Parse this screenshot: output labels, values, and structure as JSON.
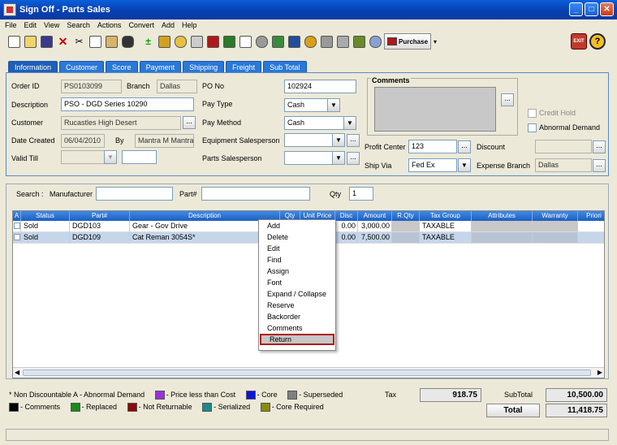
{
  "window": {
    "title": "Sign Off - Parts Sales",
    "min": "_",
    "max": "□",
    "close": "✕"
  },
  "menu": [
    "File",
    "Edit",
    "View",
    "Search",
    "Actions",
    "Convert",
    "Add",
    "Help"
  ],
  "toolbar": {
    "purchase_label": "Purchase",
    "exit_label": "EXIT",
    "help_label": "?"
  },
  "tabs": [
    "Information",
    "Customer",
    "Score",
    "Payment",
    "Shipping",
    "Freight",
    "Sub Total"
  ],
  "info": {
    "order_id_label": "Order ID",
    "order_id": "PS0103099",
    "branch_label": "Branch",
    "branch": "Dallas",
    "po_no_label": "PO No",
    "po_no": "102924",
    "description_label": "Description",
    "description": "PSO - DGD Series 10290",
    "pay_type_label": "Pay Type",
    "pay_type": "Cash",
    "customer_label": "Customer",
    "customer": "Rucastles High Desert",
    "pay_method_label": "Pay Method",
    "pay_method": "Cash",
    "date_created_label": "Date Created",
    "date_created": "06/04/2010",
    "by_label": "By",
    "by": "Mantra M Mantra",
    "equipment_salesperson_label": "Equipment Salesperson",
    "valid_till_label": "Valid Till",
    "parts_salesperson_label": "Parts Salesperson",
    "comments_label": "Comments",
    "credit_hold_label": "Credit Hold",
    "abnormal_demand_label": "Abnormal Demand",
    "profit_center_label": "Profit Center",
    "profit_center": "123",
    "discount_label": "Discount",
    "ship_via_label": "Ship Via",
    "ship_via": "Fed Ex",
    "expense_branch_label": "Expense Branch",
    "expense_branch": "Dallas"
  },
  "search": {
    "label": "Search :",
    "manufacturer_label": "Manufacturer",
    "part_label": "Part#",
    "qty_label": "Qty",
    "qty": "1"
  },
  "grid": {
    "columns": [
      "A",
      "Status",
      "Part#",
      "Description",
      "Qty",
      "Unit Price",
      "Disc",
      "Amount",
      "R.Qty",
      "Tax Group",
      "Attributes",
      "Warranty",
      "Priori"
    ],
    "rows": [
      {
        "status": "Sold",
        "part": "DGD103",
        "description": "Gear - Gov Drive",
        "disc": "0.00",
        "amount": "3,000.00",
        "tax_group": "TAXABLE"
      },
      {
        "status": "Sold",
        "part": "DGD109",
        "description": "Cat Reman 3054S*",
        "disc": "0.00",
        "amount": "7,500.00",
        "tax_group": "TAXABLE"
      }
    ]
  },
  "context_menu": [
    "Add",
    "Delete",
    "Edit",
    "Find",
    "Assign",
    "Font",
    "Expand / Collapse",
    "Reserve",
    "Backorder",
    "Comments",
    "Return"
  ],
  "legend": {
    "row1_prefix": "* Non Discountable   A - Abnormal Demand",
    "row1": [
      {
        "label": "- Price less than Cost",
        "color": "#9b30d9"
      },
      {
        "label": "- Core",
        "color": "#0a14e0"
      },
      {
        "label": "- Superseded",
        "color": "#808080"
      }
    ],
    "row2": [
      {
        "label": "- Comments",
        "color": "#000000"
      },
      {
        "label": "- Replaced",
        "color": "#1a8a1a"
      },
      {
        "label": "- Not Returnable",
        "color": "#8b0a0a"
      },
      {
        "label": "- Serialized",
        "color": "#1a8a8a"
      },
      {
        "label": "- Core Required",
        "color": "#8a8a10"
      }
    ]
  },
  "totals": {
    "tax_label": "Tax",
    "tax": "918.75",
    "subtotal_label": "SubTotal",
    "subtotal": "10,500.00",
    "total_label": "Total",
    "total": "11,418.75"
  }
}
